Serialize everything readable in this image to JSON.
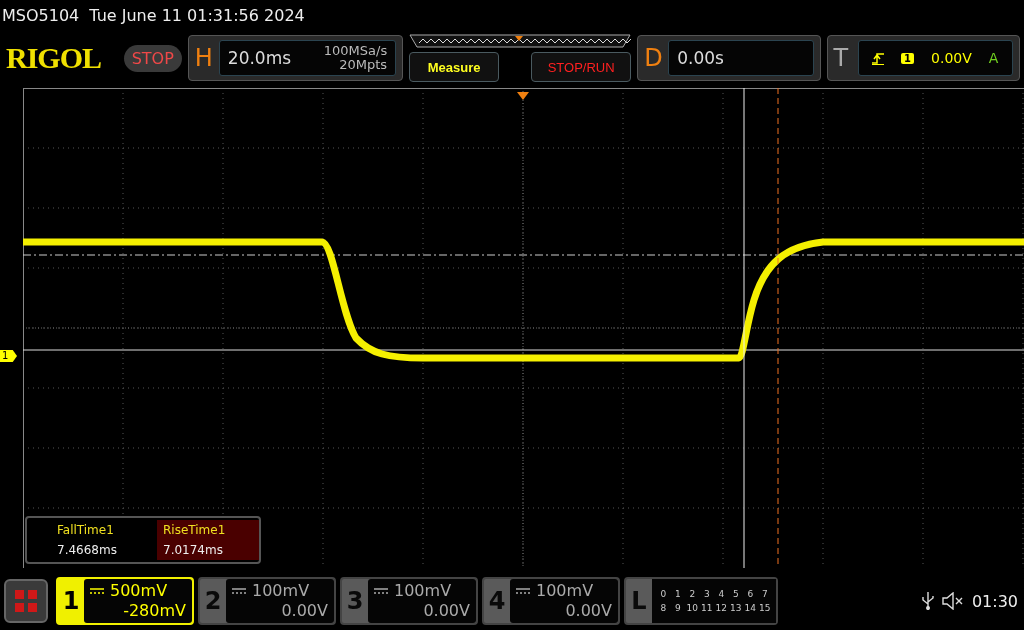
{
  "header": {
    "model": "MSO5104",
    "datetime": "Tue June 11 01:31:56 2024"
  },
  "toolbar": {
    "logo": "RIGOL",
    "run_status": "STOP",
    "horizontal": {
      "label": "H",
      "timebase": "20.0ms",
      "sample_rate": "100MSa/s",
      "memory_depth": "20Mpts"
    },
    "buttons": [
      {
        "label": "Measure",
        "kind": "measure"
      },
      {
        "label": "STOP/RUN",
        "kind": "run"
      }
    ],
    "delay": {
      "label": "D",
      "value": "0.00s"
    },
    "trigger": {
      "label": "T",
      "source": "1",
      "level": "0.00V",
      "mode": "A"
    }
  },
  "measurements": [
    {
      "name": "FallTime1",
      "value": "7.4668ms",
      "selected": false
    },
    {
      "name": "RiseTime1",
      "value": "7.0174ms",
      "selected": true
    }
  ],
  "channel_marker": "1",
  "channels": [
    {
      "number": "1",
      "scale": "500mV",
      "offset": "-280mV",
      "selected": true
    },
    {
      "number": "2",
      "scale": "100mV",
      "offset": "0.00V",
      "selected": false
    },
    {
      "number": "3",
      "scale": "100mV",
      "offset": "0.00V",
      "selected": false
    },
    {
      "number": "4",
      "scale": "100mV",
      "offset": "0.00V",
      "selected": false
    }
  ],
  "logic": {
    "label": "L",
    "rows": [
      [
        "0",
        "1",
        "2",
        "3",
        "4",
        "5",
        "6",
        "7"
      ],
      [
        "8",
        "9",
        "10",
        "11",
        "12",
        "13",
        "14",
        "15"
      ]
    ]
  },
  "status": {
    "time": "01:30"
  }
}
